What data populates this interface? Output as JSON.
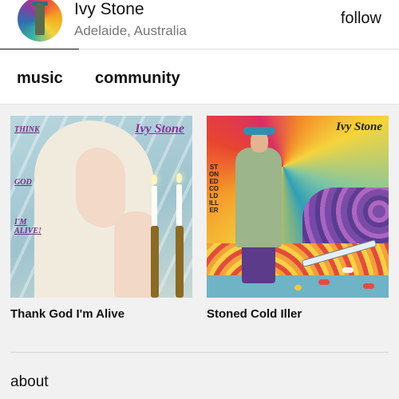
{
  "artist": {
    "name": "Ivy Stone",
    "location": "Adelaide, Australia",
    "avatar_icon": "artist-avatar"
  },
  "header": {
    "follow_label": "follow"
  },
  "tabs": [
    {
      "label": "music",
      "active": true
    },
    {
      "label": "community",
      "active": false
    }
  ],
  "releases": [
    {
      "title": "Thank God I'm Alive",
      "cover": {
        "logo": "Ivy Stone",
        "side_text": [
          "THINK",
          "GOD",
          "I'M ALIVE!"
        ]
      }
    },
    {
      "title": "Stoned Cold Iller",
      "cover": {
        "logo": "Ivy Stone",
        "side_text": "STONED COLD ILLER"
      }
    }
  ],
  "footer": {
    "about_label": "about"
  },
  "colors": {
    "background": "#f1f1f1",
    "text": "#111111",
    "muted": "#777777"
  }
}
